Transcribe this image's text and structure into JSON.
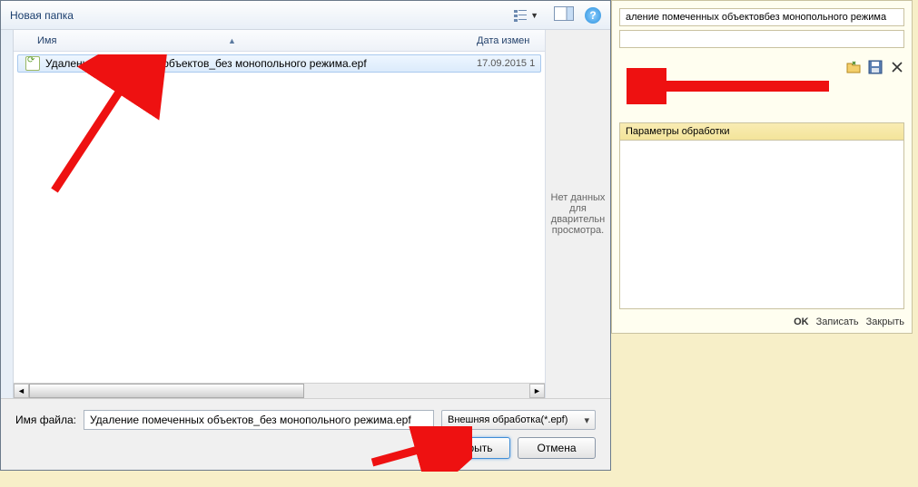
{
  "bg": {
    "title_text": "аление помеченных объектовбез монопольного режима",
    "params_header": "Параметры обработки",
    "footer": {
      "ok": "OK",
      "save": "Записать",
      "close": "Закрыть"
    }
  },
  "dialog": {
    "folder_label": "Новая папка",
    "columns": {
      "name": "Имя",
      "date": "Дата измен"
    },
    "files": [
      {
        "name": "Удаление помеченных объектов_без монопольного режима.epf",
        "date": "17.09.2015 1"
      }
    ],
    "preview_text": "Нет данных\nдля\nдварительн\nпросмотра.",
    "filename_label": "Имя файла:",
    "filename_value": "Удаление помеченных объектов_без монопольного режима.epf",
    "filetype_label": "Внешняя обработка(*.epf)",
    "open_btn": "Открыть",
    "cancel_btn": "Отмена"
  }
}
